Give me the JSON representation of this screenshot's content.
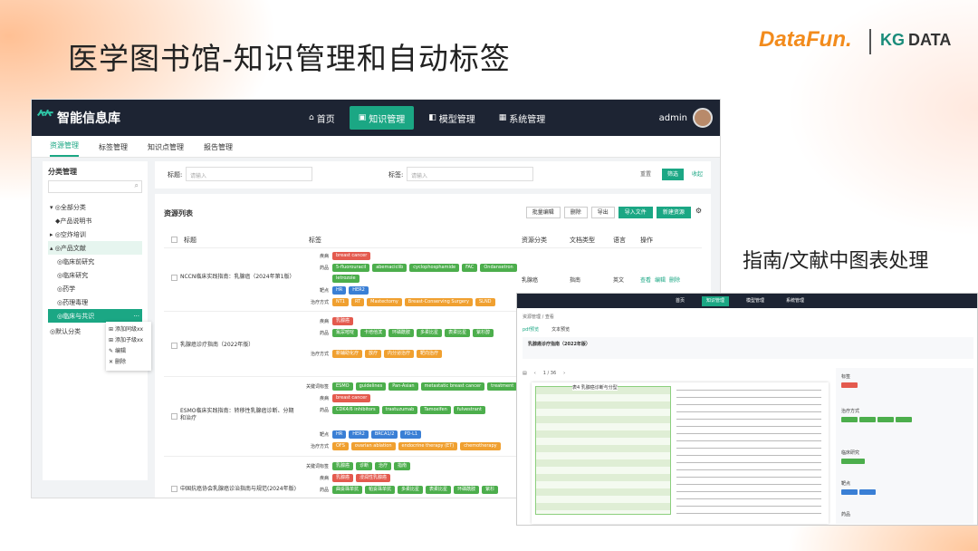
{
  "slide": {
    "title": "医学图书馆-知识管理和自动标签",
    "caption": "指南/文献中图表处理"
  },
  "logos": {
    "datafun": "DataFun.",
    "kg_mark": "KG",
    "kg_text": "DATA"
  },
  "app": {
    "brand": "智能信息库",
    "nav": [
      {
        "label": "首页",
        "icon": "home-icon"
      },
      {
        "label": "知识管理",
        "icon": "book-icon"
      },
      {
        "label": "模型管理",
        "icon": "model-icon"
      },
      {
        "label": "系统管理",
        "icon": "grid-icon"
      }
    ],
    "user": "admin",
    "subtabs": [
      "资源管理",
      "标签管理",
      "知识点管理",
      "报告管理"
    ],
    "sidebar": {
      "title": "分类管理",
      "items": [
        "全部分类",
        "产品说明书",
        "空炸培训",
        "产品文献",
        "临床前研究",
        "临床研究",
        "药学",
        "药理毒理",
        "临床与共识",
        "默认分类"
      ]
    },
    "context_menu": [
      "添加同级xx",
      "添加子级xx",
      "编辑",
      "删除"
    ],
    "filters": {
      "title_label": "标题:",
      "title_placeholder": "请输入",
      "tag_label": "标签:",
      "tag_placeholder": "请输入",
      "reset": "重置",
      "search": "筛选",
      "collapse": "收起"
    },
    "list": {
      "title": "资源列表",
      "actions": [
        "批量编辑",
        "删除",
        "导出",
        "导入文件",
        "新建资源"
      ],
      "columns": [
        "标题",
        "标签",
        "资源分类",
        "文档类型",
        "语言",
        "操作"
      ],
      "rows": [
        {
          "title": "NCCN临床实践指南：乳腺癌（2024年第1版）",
          "category": "乳腺癌",
          "doctype": "指南",
          "lang": "英文",
          "ops": [
            "查看",
            "编辑",
            "删除"
          ],
          "tags": [
            {
              "label": "疾病",
              "vals": [
                "breast cancer"
              ],
              "c": "r"
            },
            {
              "label": "药品",
              "vals": [
                "5-fluorouracil",
                "abemaciclib",
                "cyclophosphamide",
                "FAC",
                "Ondansetron",
                "letrozole"
              ],
              "c": "g"
            },
            {
              "label": "靶点",
              "vals": [
                "HR",
                "HER2"
              ],
              "c": "b"
            },
            {
              "label": "治疗方式",
              "vals": [
                "NT1",
                "RT",
                "Mastectomy",
                "Breast-Conserving Surgery",
                "SLND"
              ],
              "c": "o"
            }
          ]
        },
        {
          "title": "乳腺癌诊疗指南（2022年版）",
          "tags": [
            {
              "label": "疾病",
              "vals": [
                "乳腺癌"
              ],
              "c": "r"
            },
            {
              "label": "药品",
              "vals": [
                "氟尿嘧啶",
                "卡培他滨",
                "环磷酰胺",
                "多柔比星",
                "表柔比星",
                "紫杉醇"
              ],
              "c": "g"
            },
            {
              "label": "治疗方式",
              "vals": [
                "新辅助化疗",
                "放疗",
                "内分泌治疗",
                "靶向治疗"
              ],
              "c": "o"
            }
          ]
        },
        {
          "title": "ESMO临床实践指南：转移性乳腺癌诊断、分期和治疗",
          "tags": [
            {
              "label": "关键词标签",
              "vals": [
                "ESMO",
                "guidelines",
                "Pan-Asian",
                "metastatic breast cancer",
                "treatment"
              ],
              "c": "g"
            },
            {
              "label": "疾病",
              "vals": [
                "breast cancer"
              ],
              "c": "r"
            },
            {
              "label": "药品",
              "vals": [
                "CDK4/6 inhibitors",
                "trastuzumab",
                "Tamoxifen",
                "fulvestrant"
              ],
              "c": "g"
            },
            {
              "label": "靶点",
              "vals": [
                "HR",
                "HER2",
                "BRCA1/2",
                "PD-L1"
              ],
              "c": "b"
            },
            {
              "label": "治疗方式",
              "vals": [
                "OFS",
                "ovarian ablation",
                "endocrine therapy (ET)",
                "chemotherapy"
              ],
              "c": "o"
            }
          ]
        },
        {
          "title": "中国抗癌协会乳腺癌诊治指南与规范(2024年版)",
          "tags": [
            {
              "label": "关键词标签",
              "vals": [
                "乳腺癌",
                "诊断",
                "治疗",
                "指南"
              ],
              "c": "g"
            },
            {
              "label": "疾病",
              "vals": [
                "乳腺癌",
                "浸润性乳腺癌"
              ],
              "c": "r"
            },
            {
              "label": "药品",
              "vals": [
                "曲妥珠单抗",
                "帕妥珠单抗",
                "多柔比星",
                "表柔比星",
                "环磷酰胺",
                "紫杉"
              ],
              "c": "g"
            }
          ]
        }
      ]
    }
  },
  "doc_viewer": {
    "nav": [
      "首页",
      "知识管理",
      "模型管理",
      "系统管理"
    ],
    "breadcrumb": "资源管理 / 查看",
    "tabs": [
      "pdf预览",
      "文本预览"
    ],
    "doc_title": "乳腺癌诊疗指南（2022年版）",
    "page": "1 / 36",
    "table_title": "表4  乳腺癌诊断与分型",
    "sections": [
      "标签",
      "治疗方式",
      "临床研究",
      "靶点",
      "药品"
    ]
  }
}
